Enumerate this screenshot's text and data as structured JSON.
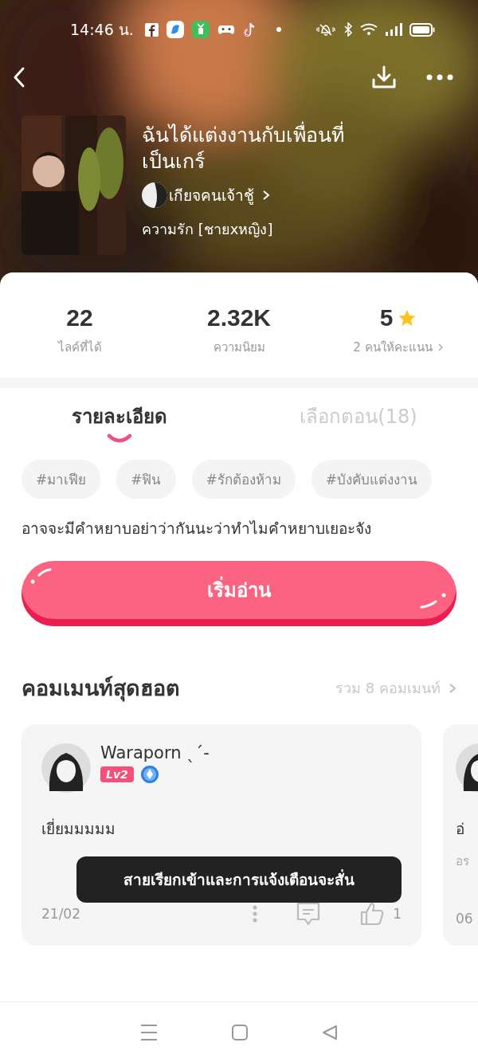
{
  "status_bar": {
    "time": "14:46 น."
  },
  "header": {
    "title": "ฉันได้แต่งงานกับเพื่อนที่เป็นเกร์",
    "author": "เกียจคนเจ้าชู้",
    "genre": "ความรัก [ชายxหญิง]"
  },
  "stats": [
    {
      "kind": "count",
      "value": "22",
      "label": "ไลค์ที่ได้"
    },
    {
      "kind": "count",
      "value": "2.32K",
      "label": "ความนิยม"
    },
    {
      "kind": "rating",
      "value": "5",
      "label": "2 คนให้คะแนน"
    }
  ],
  "tabs": [
    {
      "label": "รายละเอียด",
      "selected": true
    },
    {
      "label": "เลือกตอน(18)",
      "selected": false
    }
  ],
  "tags": [
    "#มาเฟีย",
    "#ฟิน",
    "#รักต้องห้าม",
    "#บังคับแต่งงาน"
  ],
  "description": "อาจจะมีคำหยาบอย่าว่ากันนะว่าทำไมคำหยาบเยอะจัง",
  "start_button": "เริ่มอ่าน",
  "comments_section": {
    "title": "คอมเมนท์สุดฮอต",
    "total": "รวม 8 คอมเมนท์"
  },
  "comments": [
    {
      "user": "Waraporn ˎˊ-",
      "level": "Lv2",
      "text": "เยี่ยมมมมม",
      "date": "21/02",
      "likes": "1"
    },
    {
      "text": "อ่",
      "subtitle": "อร",
      "date": "06"
    }
  ],
  "toast": "สายเรียกเข้าและการแจ้งเตือนจะสั่น"
}
